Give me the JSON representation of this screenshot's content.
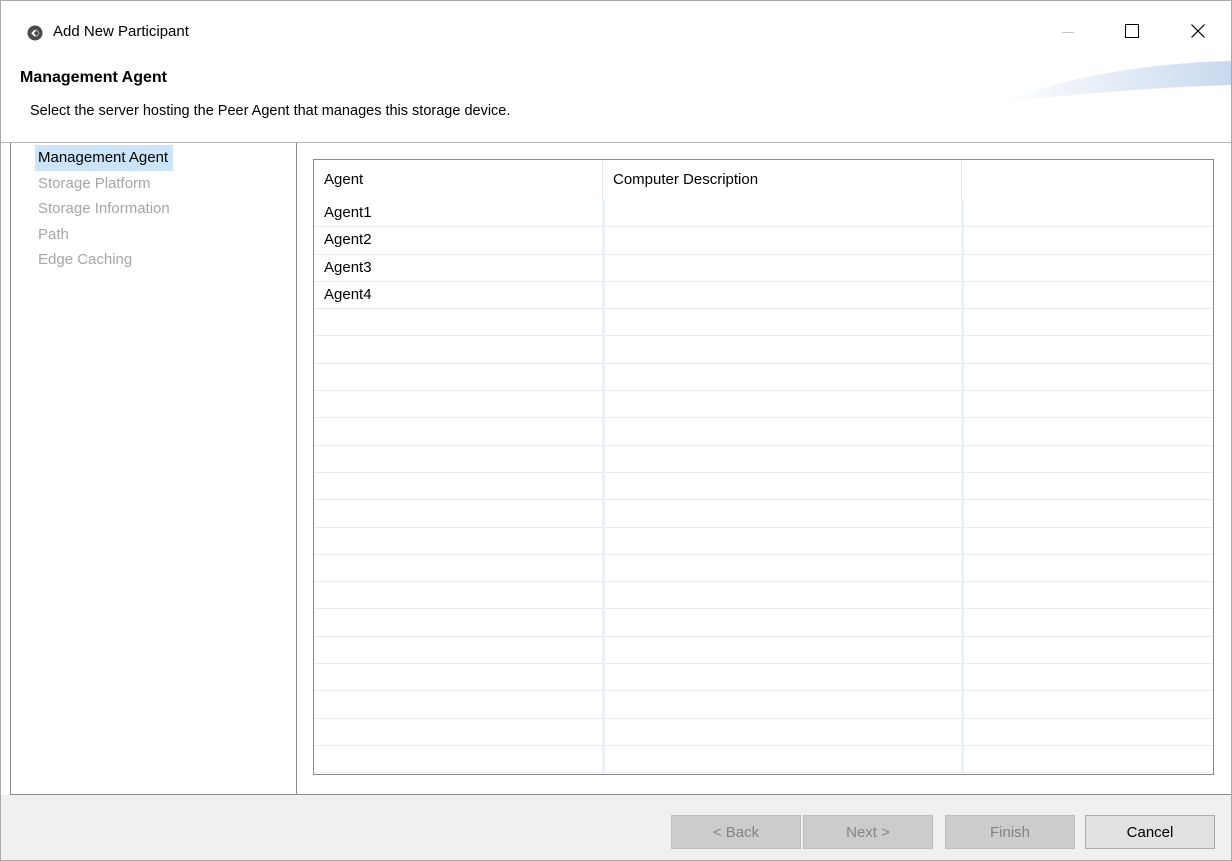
{
  "window": {
    "title": "Add New Participant",
    "icon": "app-logo-icon",
    "controls": [
      "minimize-icon",
      "maximize-icon",
      "close-icon"
    ]
  },
  "header": {
    "title": "Management Agent",
    "description": "Select the server hosting the Peer Agent that manages this storage device."
  },
  "nav": {
    "items": [
      {
        "label": "Management Agent",
        "state": "active"
      },
      {
        "label": "Storage Platform",
        "state": "disabled"
      },
      {
        "label": "Storage Information",
        "state": "disabled"
      },
      {
        "label": "Path",
        "state": "disabled"
      },
      {
        "label": "Edge Caching",
        "state": "disabled"
      }
    ]
  },
  "table": {
    "columns": [
      "Agent",
      "Computer Description",
      ""
    ],
    "rows": [
      [
        "Agent1",
        "",
        ""
      ],
      [
        "Agent2",
        "",
        ""
      ],
      [
        "Agent3",
        "",
        ""
      ],
      [
        "Agent4",
        "",
        ""
      ]
    ]
  },
  "footer": {
    "back_label": "< Back",
    "next_label": "Next >",
    "finish_label": "Finish",
    "cancel_label": "Cancel"
  },
  "colors": {
    "selection": "#cce4f7",
    "disabled_text": "#a6a6a6",
    "footer_bg": "#f0f0f0"
  }
}
